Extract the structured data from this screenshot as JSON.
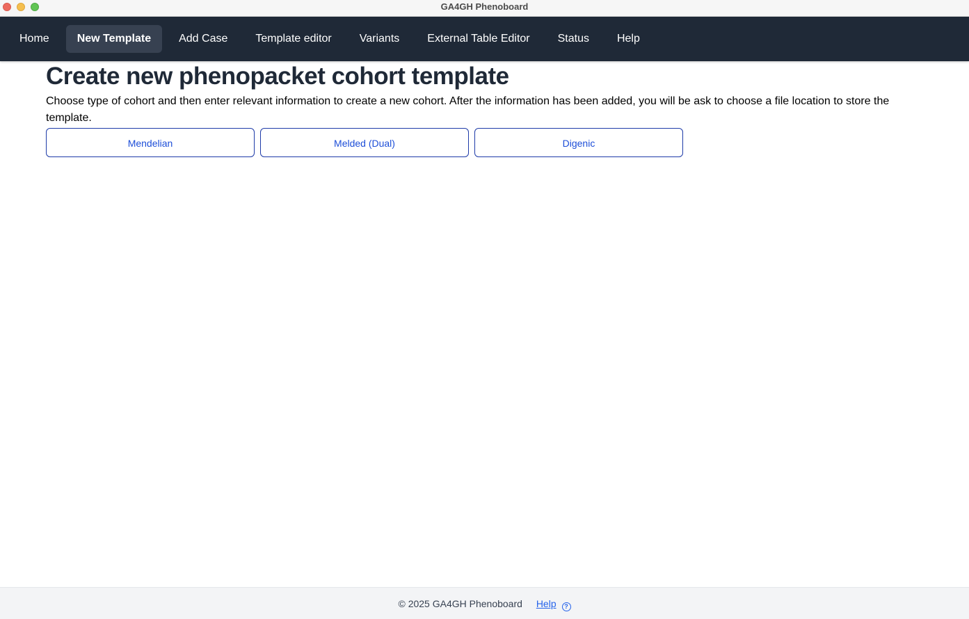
{
  "window": {
    "title": "GA4GH Phenoboard"
  },
  "nav": {
    "items": [
      {
        "label": "Home",
        "active": false
      },
      {
        "label": "New Template",
        "active": true
      },
      {
        "label": "Add Case",
        "active": false
      },
      {
        "label": "Template editor",
        "active": false
      },
      {
        "label": "Variants",
        "active": false
      },
      {
        "label": "External Table Editor",
        "active": false
      },
      {
        "label": "Status",
        "active": false
      },
      {
        "label": "Help",
        "active": false
      }
    ]
  },
  "main": {
    "title": "Create new phenopacket cohort template",
    "description": "Choose type of cohort and then enter relevant information to create a new cohort. After the information has been added, you will be ask to choose a file location to store the template.",
    "buttons": {
      "mendelian": "Mendelian",
      "melded": "Melded (Dual)",
      "digenic": "Digenic"
    }
  },
  "footer": {
    "copyright": "© 2025 GA4GH Phenoboard",
    "help_label": "Help",
    "help_icon": "?"
  },
  "colors": {
    "navbar_bg": "#1f2937",
    "active_nav_bg": "#374151",
    "button_border": "#1d3aa8",
    "button_text": "#1d4ed8",
    "link": "#2563eb"
  }
}
